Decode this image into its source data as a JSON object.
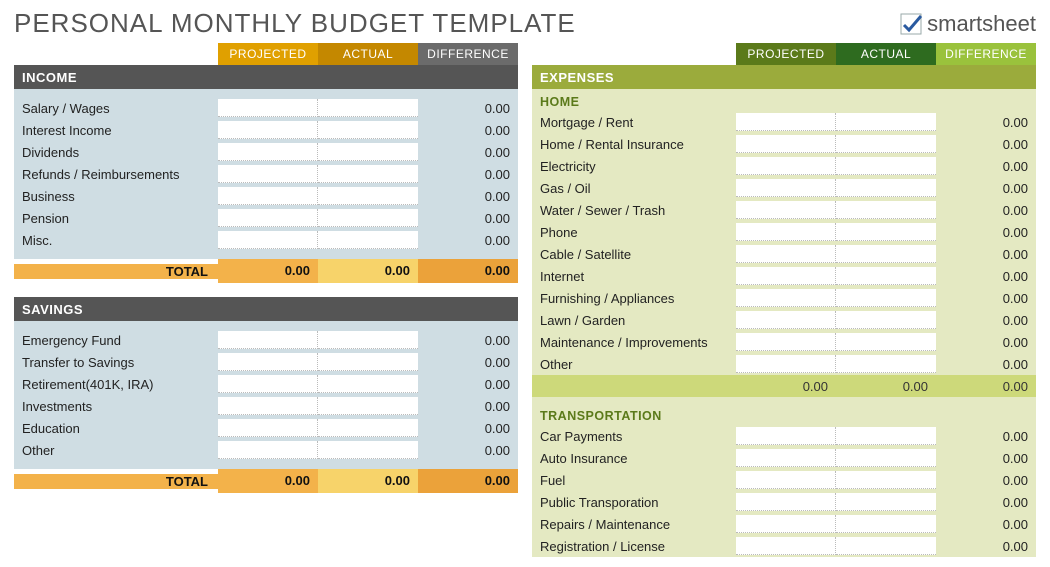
{
  "title": "PERSONAL MONTHLY BUDGET TEMPLATE",
  "logo_text": "smartsheet",
  "colheads": {
    "projected": "PROJECTED",
    "actual": "ACTUAL",
    "difference": "DIFFERENCE"
  },
  "zero": "0.00",
  "sections": {
    "income": {
      "title": "INCOME",
      "items": [
        "Salary / Wages",
        "Interest Income",
        "Dividends",
        "Refunds / Reimbursements",
        "Business",
        "Pension",
        "Misc."
      ],
      "total_label": "TOTAL",
      "total": {
        "projected": "0.00",
        "actual": "0.00",
        "difference": "0.00"
      }
    },
    "savings": {
      "title": "SAVINGS",
      "items": [
        "Emergency Fund",
        "Transfer to Savings",
        "Retirement(401K, IRA)",
        "Investments",
        "Education",
        "Other"
      ],
      "total_label": "TOTAL",
      "total": {
        "projected": "0.00",
        "actual": "0.00",
        "difference": "0.00"
      }
    },
    "expenses": {
      "title": "EXPENSES",
      "home": {
        "title": "HOME",
        "items": [
          "Mortgage / Rent",
          "Home / Rental Insurance",
          "Electricity",
          "Gas / Oil",
          "Water / Sewer / Trash",
          "Phone",
          "Cable / Satellite",
          "Internet",
          "Furnishing / Appliances",
          "Lawn / Garden",
          "Maintenance / Improvements",
          "Other"
        ],
        "subtotal": {
          "projected": "0.00",
          "actual": "0.00",
          "difference": "0.00"
        }
      },
      "transportation": {
        "title": "TRANSPORTATION",
        "items": [
          "Car Payments",
          "Auto Insurance",
          "Fuel",
          "Public Transporation",
          "Repairs / Maintenance",
          "Registration / License"
        ]
      }
    }
  }
}
